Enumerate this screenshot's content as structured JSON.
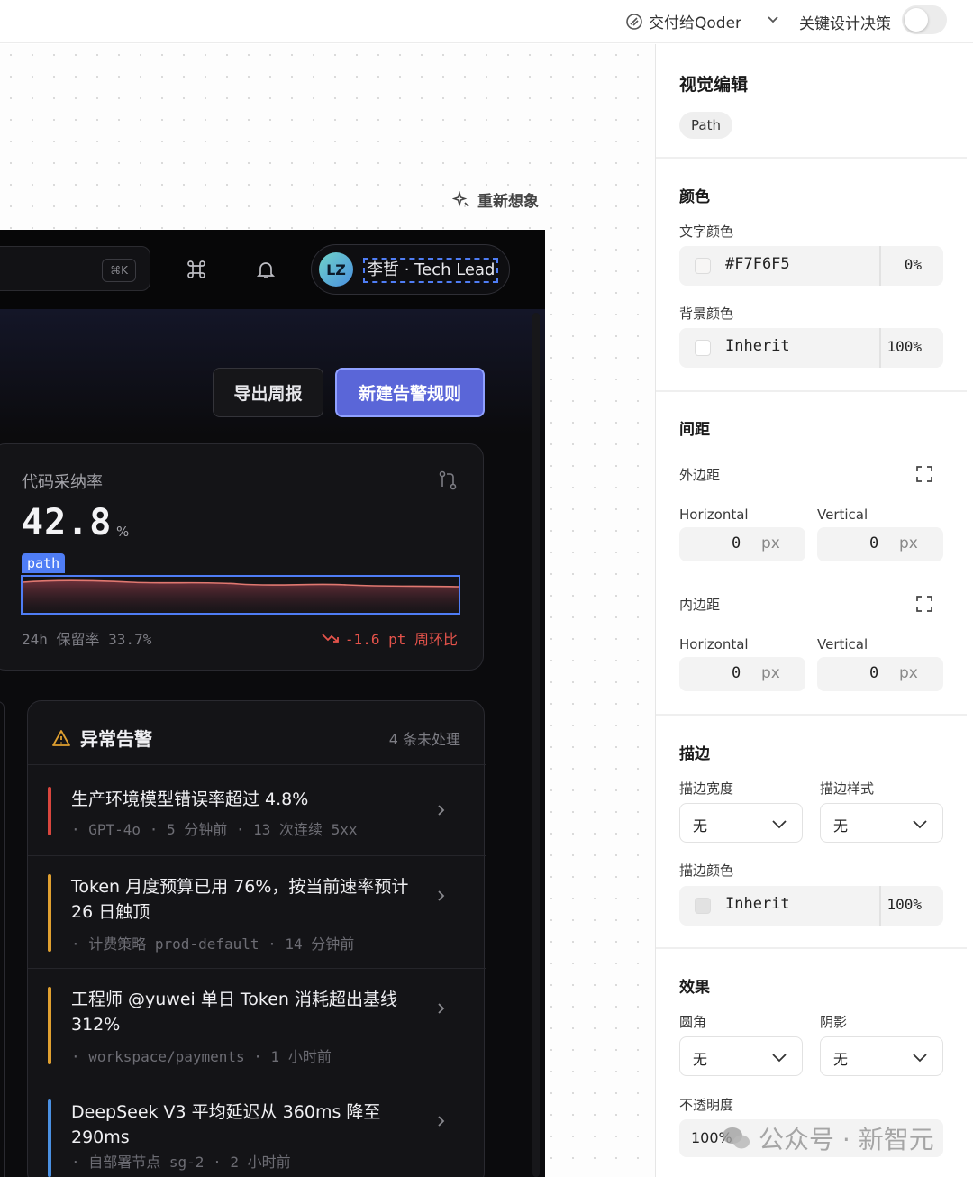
{
  "topbar": {
    "handoff_label": "交付给Qoder",
    "key_decision_label": "关键设计决策",
    "toggle_on": false
  },
  "canvas": {
    "reimagine_label": "重新想象"
  },
  "app": {
    "kbd_hint": "⌘K",
    "user": {
      "initials": "LZ",
      "name": "李哲 · Tech Lead"
    },
    "export_button": "导出周报",
    "new_rule_button": "新建告警规则",
    "metric_card": {
      "title": "代码采纳率",
      "value": "42.8",
      "unit": "%",
      "path_tag": "path",
      "retention": "24h 保留率 33.7%",
      "trend": "-1.6 pt 周环比",
      "trend_color": "#e5534b"
    },
    "alerts": {
      "title": "异常告警",
      "count": "4 条未处理",
      "items": [
        {
          "title": "生产环境模型错误率超过 4.8%",
          "meta": "· GPT-4o · 5 分钟前 · 13 次连续 5xx",
          "color": "#d9463e"
        },
        {
          "title": "Token 月度预算已用 76%，按当前速率预计 26 日触顶",
          "meta": "· 计费策略 prod-default · 14 分钟前",
          "color": "#e0a030"
        },
        {
          "title": "工程师 @yuwei 单日 Token 消耗超出基线 312%",
          "meta": "· workspace/payments · 1 小时前",
          "color": "#e0a030"
        },
        {
          "title": "DeepSeek V3 平均延迟从 360ms 降至 290ms",
          "meta": "· 自部署节点 sg-2 · 2 小时前",
          "color": "#4a90e2"
        }
      ]
    }
  },
  "panel": {
    "title": "视觉编辑",
    "element_chip": "Path",
    "color_section": {
      "heading": "颜色",
      "text_color_label": "文字颜色",
      "text_color_value": "#F7F6F5",
      "text_color_opacity": "0%",
      "bg_color_label": "背景颜色",
      "bg_color_value": "Inherit",
      "bg_color_opacity": "100%"
    },
    "spacing_section": {
      "heading": "间距",
      "margin_label": "外边距",
      "padding_label": "内边距",
      "horizontal_label": "Horizontal",
      "vertical_label": "Vertical",
      "margin_h": "0",
      "margin_v": "0",
      "padding_h": "0",
      "padding_v": "0",
      "unit": "px"
    },
    "stroke_section": {
      "heading": "描边",
      "width_label": "描边宽度",
      "style_label": "描边样式",
      "width_value": "无",
      "style_value": "无",
      "color_label": "描边颜色",
      "color_value": "Inherit",
      "color_opacity": "100%"
    },
    "effects_section": {
      "heading": "效果",
      "radius_label": "圆角",
      "shadow_label": "阴影",
      "radius_value": "无",
      "shadow_value": "无",
      "opacity_label": "不透明度",
      "opacity_value": "100%"
    }
  },
  "watermark": "公众号 · 新智元"
}
